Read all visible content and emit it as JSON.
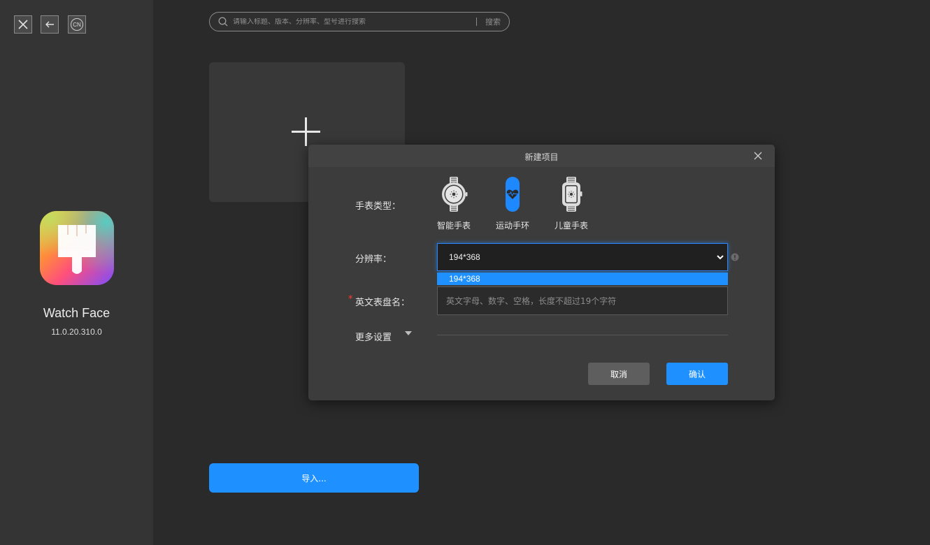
{
  "sidebar": {
    "top_buttons": {
      "language_label": "CN"
    },
    "app": {
      "name": "Watch Face",
      "version": "11.0.20.310.0"
    }
  },
  "search": {
    "placeholder": "请输入标题、版本、分辨率、型号进行搜索",
    "button_label": "搜索"
  },
  "main": {
    "import_label": "导入..."
  },
  "colors": {
    "accent": "#1e90ff",
    "required": "#ff3b30",
    "background": "#2a2a2a",
    "sidebar": "#343434",
    "dialog": "#3c3c3c"
  },
  "dialog": {
    "title": "新建项目",
    "watch_type": {
      "label": "手表类型：",
      "selected_index": 1,
      "options": [
        {
          "label": "智能手表",
          "icon": "smartwatch-icon"
        },
        {
          "label": "运动手环",
          "icon": "fitness-band-icon"
        },
        {
          "label": "儿童手表",
          "icon": "kids-watch-icon"
        }
      ]
    },
    "resolution": {
      "label": "分辨率：",
      "value": "194*368",
      "options": [
        "194*368"
      ]
    },
    "english_name": {
      "label": "英文表盘名：",
      "required_mark": "*",
      "placeholder": "英文字母、数字、空格，长度不超过19个字符",
      "value": ""
    },
    "more_settings": {
      "label": "更多设置"
    },
    "cancel_label": "取消",
    "confirm_label": "确认"
  }
}
